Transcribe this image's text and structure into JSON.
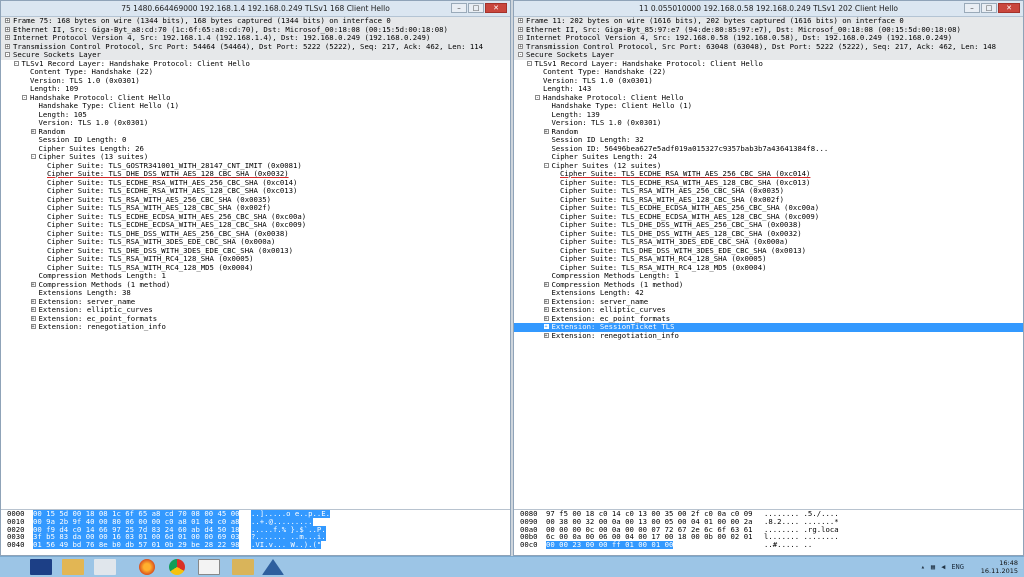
{
  "left": {
    "title": "75 1480.664469000 192.168.1.4 192.168.0.249 TLSv1 168 Client Hello",
    "tree": [
      {
        "d": 0,
        "t": "+",
        "s": "Frame 75: 168 bytes on wire (1344 bits), 168 bytes captured (1344 bits) on interface 0",
        "hdr": true
      },
      {
        "d": 0,
        "t": "+",
        "s": "Ethernet II, Src: Giga-Byt_a8:cd:70 (1c:6f:65:a8:cd:70), Dst: Microsof_00:18:08 (00:15:5d:00:18:08)",
        "hdr": true
      },
      {
        "d": 0,
        "t": "+",
        "s": "Internet Protocol Version 4, Src: 192.168.1.4 (192.168.1.4), Dst: 192.168.0.249 (192.168.0.249)",
        "hdr": true
      },
      {
        "d": 0,
        "t": "+",
        "s": "Transmission Control Protocol, Src Port: 54464 (54464), Dst Port: 5222 (5222), Seq: 217, Ack: 462, Len: 114",
        "hdr": true
      },
      {
        "d": 0,
        "t": "-",
        "s": "Secure Sockets Layer",
        "hdr": true
      },
      {
        "d": 1,
        "t": "-",
        "s": "TLSv1 Record Layer: Handshake Protocol: Client Hello"
      },
      {
        "d": 2,
        "t": "",
        "s": "Content Type: Handshake (22)"
      },
      {
        "d": 2,
        "t": "",
        "s": "Version: TLS 1.0 (0x0301)"
      },
      {
        "d": 2,
        "t": "",
        "s": "Length: 109"
      },
      {
        "d": 2,
        "t": "-",
        "s": "Handshake Protocol: Client Hello"
      },
      {
        "d": 3,
        "t": "",
        "s": "Handshake Type: Client Hello (1)"
      },
      {
        "d": 3,
        "t": "",
        "s": "Length: 105"
      },
      {
        "d": 3,
        "t": "",
        "s": "Version: TLS 1.0 (0x0301)"
      },
      {
        "d": 3,
        "t": "+",
        "s": "Random"
      },
      {
        "d": 3,
        "t": "",
        "s": "Session ID Length: 0"
      },
      {
        "d": 3,
        "t": "",
        "s": "Cipher Suites Length: 26"
      },
      {
        "d": 3,
        "t": "-",
        "s": "Cipher Suites (13 suites)"
      },
      {
        "d": 4,
        "t": "",
        "s": "Cipher Suite: TLS_GOSTR341001_WITH_28147_CNT_IMIT (0x0081)"
      },
      {
        "d": 4,
        "t": "",
        "s": "Cipher Suite: TLS_DHE_DSS_WITH_AES_128_CBC_SHA (0x0032)",
        "u": true
      },
      {
        "d": 4,
        "t": "",
        "s": "Cipher Suite: TLS_ECDHE_RSA_WITH_AES_256_CBC_SHA (0xc014)"
      },
      {
        "d": 4,
        "t": "",
        "s": "Cipher Suite: TLS_ECDHE_RSA_WITH_AES_128_CBC_SHA (0xc013)"
      },
      {
        "d": 4,
        "t": "",
        "s": "Cipher Suite: TLS_RSA_WITH_AES_256_CBC_SHA (0x0035)"
      },
      {
        "d": 4,
        "t": "",
        "s": "Cipher Suite: TLS_RSA_WITH_AES_128_CBC_SHA (0x002f)"
      },
      {
        "d": 4,
        "t": "",
        "s": "Cipher Suite: TLS_ECDHE_ECDSA_WITH_AES_256_CBC_SHA (0xc00a)"
      },
      {
        "d": 4,
        "t": "",
        "s": "Cipher Suite: TLS_ECDHE_ECDSA_WITH_AES_128_CBC_SHA (0xc009)"
      },
      {
        "d": 4,
        "t": "",
        "s": "Cipher Suite: TLS_DHE_DSS_WITH_AES_256_CBC_SHA (0x0038)"
      },
      {
        "d": 4,
        "t": "",
        "s": "Cipher Suite: TLS_RSA_WITH_3DES_EDE_CBC_SHA (0x000a)"
      },
      {
        "d": 4,
        "t": "",
        "s": "Cipher Suite: TLS_DHE_DSS_WITH_3DES_EDE_CBC_SHA (0x0013)"
      },
      {
        "d": 4,
        "t": "",
        "s": "Cipher Suite: TLS_RSA_WITH_RC4_128_SHA (0x0005)"
      },
      {
        "d": 4,
        "t": "",
        "s": "Cipher Suite: TLS_RSA_WITH_RC4_128_MD5 (0x0004)"
      },
      {
        "d": 3,
        "t": "",
        "s": "Compression Methods Length: 1"
      },
      {
        "d": 3,
        "t": "+",
        "s": "Compression Methods (1 method)"
      },
      {
        "d": 3,
        "t": "",
        "s": "Extensions Length: 38"
      },
      {
        "d": 3,
        "t": "+",
        "s": "Extension: server_name"
      },
      {
        "d": 3,
        "t": "+",
        "s": "Extension: elliptic_curves"
      },
      {
        "d": 3,
        "t": "+",
        "s": "Extension: ec_point_formats"
      },
      {
        "d": 3,
        "t": "+",
        "s": "Extension: renegotiation_info"
      }
    ],
    "hex": [
      {
        "off": "0000",
        "bytes": "00 15 5d 00 18 08 1c 6f  65 a8 cd 70 08 00 45 00",
        "ascii": "..].....o e..p..E."
      },
      {
        "off": "0010",
        "bytes": "00 9a 2b 9f 40 00 80 06  00 00 c0 a8 01 04 c0 a8",
        "ascii": "..+.@........."
      },
      {
        "off": "0020",
        "bytes": "00 f9 d4 c0 14 66 97 25  7d 83 24 60 ab d4 50 18",
        "ascii": ".....f.% }.$`..P."
      },
      {
        "off": "0030",
        "bytes": "3f b5 83 da 00 00 16 03  01 00 6d 01 00 00 69 03",
        "ascii": "?.......  ..m...i."
      },
      {
        "off": "0040",
        "bytes": "01 56 49 bd 76 8e b0 db  57 01 0b 29 be 28 22 98",
        "ascii": ".VI.v... W..).(\""
      }
    ]
  },
  "right": {
    "title": "11 0.055010000 192.168.0.58 192.168.0.249 TLSv1 202 Client Hello",
    "tree": [
      {
        "d": 0,
        "t": "+",
        "s": "Frame 11: 202 bytes on wire (1616 bits), 202 bytes captured (1616 bits) on interface 0",
        "hdr": true
      },
      {
        "d": 0,
        "t": "+",
        "s": "Ethernet II, Src: Giga-Byt_85:97:e7 (94:de:80:85:97:e7), Dst: Microsof_00:18:08 (00:15:5d:00:18:08)",
        "hdr": true
      },
      {
        "d": 0,
        "t": "+",
        "s": "Internet Protocol Version 4, Src: 192.168.0.58 (192.168.0.58), Dst: 192.168.0.249 (192.168.0.249)",
        "hdr": true
      },
      {
        "d": 0,
        "t": "+",
        "s": "Transmission Control Protocol, Src Port: 63048 (63048), Dst Port: 5222 (5222), Seq: 217, Ack: 462, Len: 148",
        "hdr": true
      },
      {
        "d": 0,
        "t": "-",
        "s": "Secure Sockets Layer",
        "hdr": true
      },
      {
        "d": 1,
        "t": "-",
        "s": "TLSv1 Record Layer: Handshake Protocol: Client Hello"
      },
      {
        "d": 2,
        "t": "",
        "s": "Content Type: Handshake (22)"
      },
      {
        "d": 2,
        "t": "",
        "s": "Version: TLS 1.0 (0x0301)"
      },
      {
        "d": 2,
        "t": "",
        "s": "Length: 143"
      },
      {
        "d": 2,
        "t": "-",
        "s": "Handshake Protocol: Client Hello"
      },
      {
        "d": 3,
        "t": "",
        "s": "Handshake Type: Client Hello (1)"
      },
      {
        "d": 3,
        "t": "",
        "s": "Length: 139"
      },
      {
        "d": 3,
        "t": "",
        "s": "Version: TLS 1.0 (0x0301)"
      },
      {
        "d": 3,
        "t": "+",
        "s": "Random"
      },
      {
        "d": 3,
        "t": "",
        "s": "Session ID Length: 32"
      },
      {
        "d": 3,
        "t": "",
        "s": "Session ID: 56496bea627e5adf019a015327c9357bab3b7a43641384f8..."
      },
      {
        "d": 3,
        "t": "",
        "s": "Cipher Suites Length: 24"
      },
      {
        "d": 3,
        "t": "-",
        "s": "Cipher Suites (12 suites)"
      },
      {
        "d": 4,
        "t": "",
        "s": "Cipher Suite: TLS_ECDHE_RSA_WITH_AES_256_CBC_SHA (0xc014)",
        "u": true
      },
      {
        "d": 4,
        "t": "",
        "s": "Cipher Suite: TLS_ECDHE_RSA_WITH_AES_128_CBC_SHA (0xc013)"
      },
      {
        "d": 4,
        "t": "",
        "s": "Cipher Suite: TLS_RSA_WITH_AES_256_CBC_SHA (0x0035)"
      },
      {
        "d": 4,
        "t": "",
        "s": "Cipher Suite: TLS_RSA_WITH_AES_128_CBC_SHA (0x002f)"
      },
      {
        "d": 4,
        "t": "",
        "s": "Cipher Suite: TLS_ECDHE_ECDSA_WITH_AES_256_CBC_SHA (0xc00a)"
      },
      {
        "d": 4,
        "t": "",
        "s": "Cipher Suite: TLS_ECDHE_ECDSA_WITH_AES_128_CBC_SHA (0xc009)"
      },
      {
        "d": 4,
        "t": "",
        "s": "Cipher Suite: TLS_DHE_DSS_WITH_AES_256_CBC_SHA (0x0038)"
      },
      {
        "d": 4,
        "t": "",
        "s": "Cipher Suite: TLS_DHE_DSS_WITH_AES_128_CBC_SHA (0x0032)"
      },
      {
        "d": 4,
        "t": "",
        "s": "Cipher Suite: TLS_RSA_WITH_3DES_EDE_CBC_SHA (0x000a)"
      },
      {
        "d": 4,
        "t": "",
        "s": "Cipher Suite: TLS_DHE_DSS_WITH_3DES_EDE_CBC_SHA (0x0013)"
      },
      {
        "d": 4,
        "t": "",
        "s": "Cipher Suite: TLS_RSA_WITH_RC4_128_SHA (0x0005)"
      },
      {
        "d": 4,
        "t": "",
        "s": "Cipher Suite: TLS_RSA_WITH_RC4_128_MD5 (0x0004)"
      },
      {
        "d": 3,
        "t": "",
        "s": "Compression Methods Length: 1"
      },
      {
        "d": 3,
        "t": "+",
        "s": "Compression Methods (1 method)"
      },
      {
        "d": 3,
        "t": "",
        "s": "Extensions Length: 42"
      },
      {
        "d": 3,
        "t": "+",
        "s": "Extension: server_name"
      },
      {
        "d": 3,
        "t": "+",
        "s": "Extension: elliptic_curves"
      },
      {
        "d": 3,
        "t": "+",
        "s": "Extension: ec_point_formats"
      },
      {
        "d": 3,
        "t": "+",
        "s": "Extension: SessionTicket TLS",
        "sel": true
      },
      {
        "d": 3,
        "t": "+",
        "s": "Extension: renegotiation_info"
      }
    ],
    "hex": [
      {
        "off": "0080",
        "bytes": "97 f5 00 18 c0 14 c0 13  00 35 00 2f c0 0a c0 09",
        "ascii": "........ .5./...."
      },
      {
        "off": "0090",
        "bytes": "00 38 00 32 00 0a 00 13  00 05 00 04 01 00 00 2a",
        "ascii": ".8.2.... .......*"
      },
      {
        "off": "00a0",
        "bytes": "00 00 00 0c 00 0a 00 00  07 72 67 2e 6c 6f 63 61",
        "ascii": "........ .rg.loca"
      },
      {
        "off": "00b0",
        "bytes": "6c 00 0a 00 06 00 04 00  17 00 18 00 0b 00 02 01",
        "ascii": "l.......  ........"
      },
      {
        "off": "00c0",
        "bytes": "00 00 23 00 00 ff 01 00  01 00",
        "ascii": "..#..... .."
      }
    ]
  },
  "window_buttons": {
    "min": "–",
    "max": "□",
    "close": "✕"
  },
  "taskbar": {
    "apps": [
      "start",
      "taskmgr",
      "explorer",
      "firefox",
      "chrome",
      "notepad",
      "files",
      "wireshark"
    ],
    "tray_lang": "ENG",
    "time": "16:48",
    "date": "16.11.2015"
  }
}
